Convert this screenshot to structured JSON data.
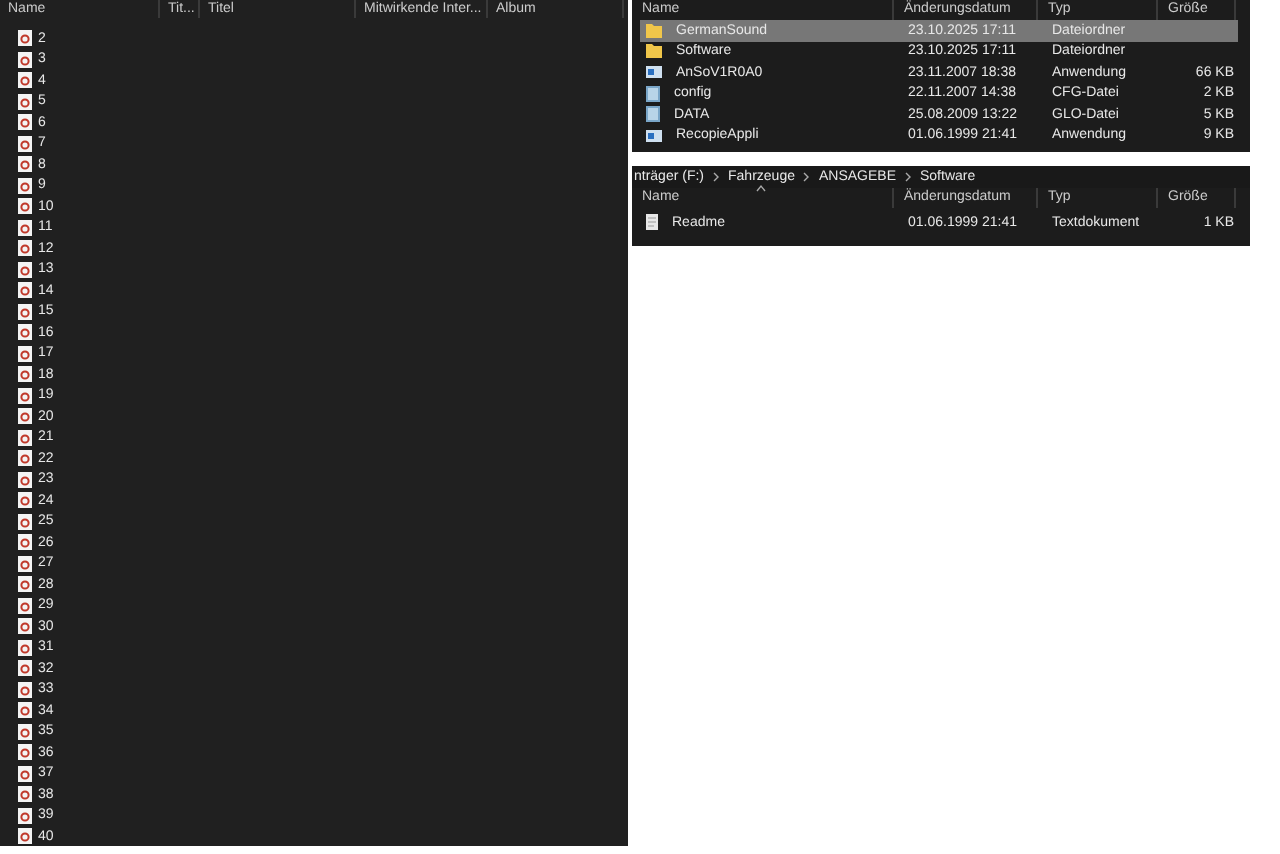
{
  "music_list": {
    "columns": [
      "Name",
      "Tit...",
      "Titel",
      "Mitwirkende Inter...",
      "Album"
    ],
    "rows": [
      "2",
      "3",
      "4",
      "5",
      "6",
      "7",
      "8",
      "9",
      "10",
      "11",
      "12",
      "13",
      "14",
      "15",
      "16",
      "17",
      "18",
      "19",
      "20",
      "21",
      "22",
      "23",
      "24",
      "25",
      "26",
      "27",
      "28",
      "29",
      "30",
      "31",
      "32",
      "33",
      "34",
      "35",
      "36",
      "37",
      "38",
      "39",
      "40"
    ]
  },
  "folder_view": {
    "columns": [
      "Name",
      "Änderungsdatum",
      "Typ",
      "Größe"
    ],
    "rows": [
      {
        "name": "GermanSound",
        "date": "23.10.2025 17:11",
        "type": "Dateiordner",
        "size": "",
        "kind": "folder",
        "selected": true
      },
      {
        "name": "Software",
        "date": "23.10.2025 17:11",
        "type": "Dateiordner",
        "size": "",
        "kind": "folder",
        "selected": false
      },
      {
        "name": "AnSoV1R0A0",
        "date": "23.11.2007 18:38",
        "type": "Anwendung",
        "size": "66 KB",
        "kind": "app",
        "selected": false
      },
      {
        "name": "config",
        "date": "22.11.2007 14:38",
        "type": "CFG-Datei",
        "size": "2 KB",
        "kind": "file",
        "selected": false
      },
      {
        "name": "DATA",
        "date": "25.08.2009 13:22",
        "type": "GLO-Datei",
        "size": "5 KB",
        "kind": "file",
        "selected": false
      },
      {
        "name": "RecopieAppli",
        "date": "01.06.1999 21:41",
        "type": "Anwendung",
        "size": "9 KB",
        "kind": "app",
        "selected": false
      }
    ]
  },
  "software_view": {
    "breadcrumb": [
      "nträger (F:)",
      "Fahrzeuge",
      "ANSAGEBE",
      "Software"
    ],
    "columns": [
      "Name",
      "Änderungsdatum",
      "Typ",
      "Größe"
    ],
    "rows": [
      {
        "name": "Readme",
        "date": "01.06.1999 21:41",
        "type": "Textdokument",
        "size": "1 KB",
        "kind": "text",
        "selected": false
      }
    ]
  }
}
